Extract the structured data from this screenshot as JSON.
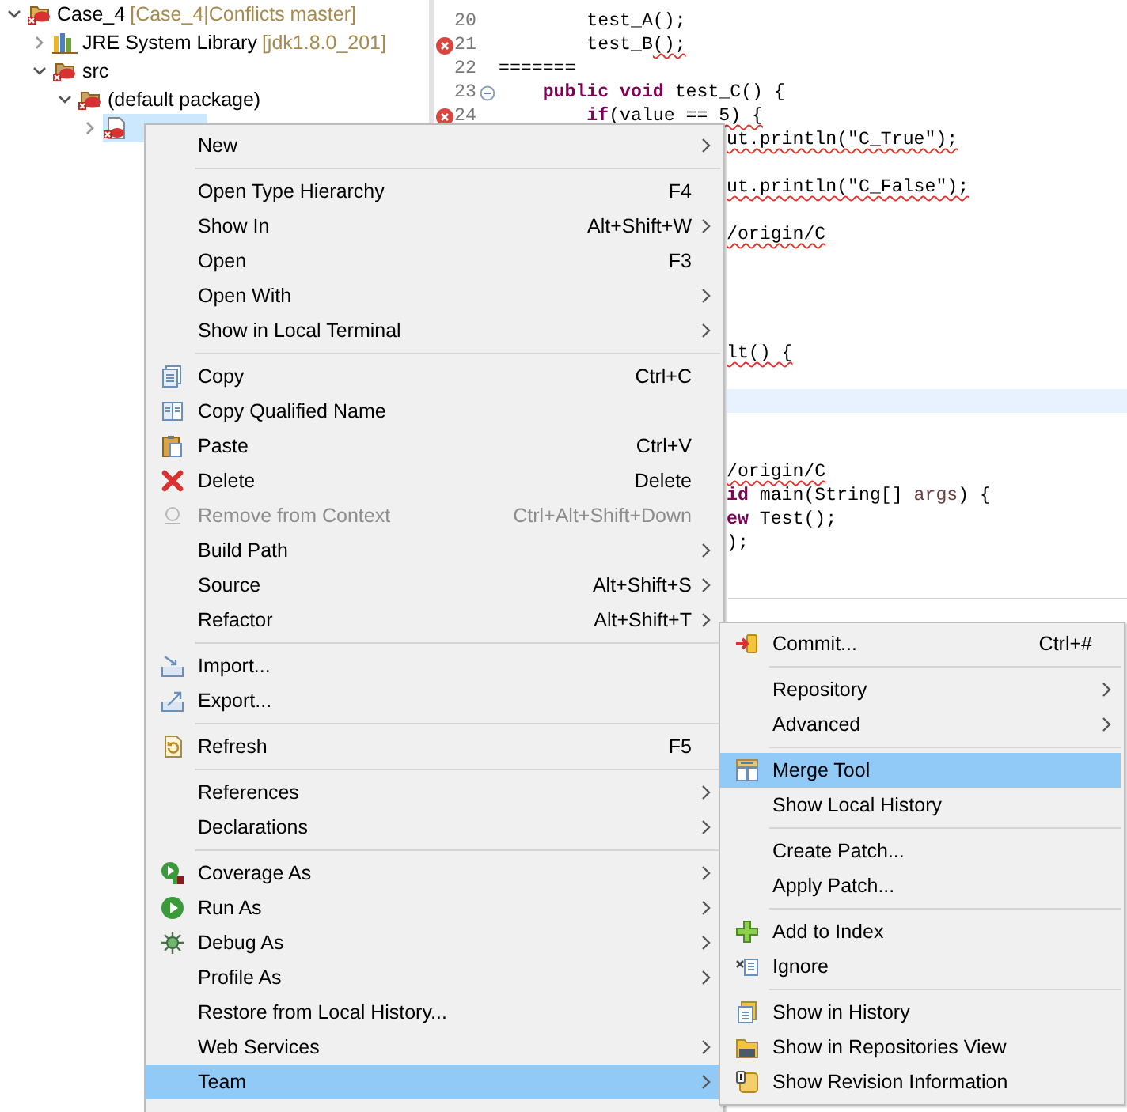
{
  "tree": [
    {
      "label": "Case_4",
      "decoration": "[Case_4|Conflicts master]",
      "expanded": true,
      "selected": false,
      "children": [
        {
          "label": "JRE System Library",
          "decoration": "[jdk1.8.0_201]",
          "expanded": false,
          "selected": false
        },
        {
          "label": "src",
          "expanded": true,
          "selected": false,
          "children": [
            {
              "label": "(default package)",
              "expanded": true,
              "selected": false,
              "children": [
                {
                  "expanded": false,
                  "selected": true
                }
              ]
            }
          ]
        }
      ]
    }
  ],
  "editor": {
    "lines": [
      {
        "kind": "full",
        "number": "20",
        "error": false,
        "fold": false,
        "segments": [
          {
            "kind": "text",
            "text": "        test_A();"
          }
        ]
      },
      {
        "kind": "full",
        "number": "21",
        "error": true,
        "fold": false,
        "segments": [
          {
            "kind": "text",
            "text": "        test_B"
          },
          {
            "kind": "error",
            "text": "();"
          }
        ]
      },
      {
        "kind": "full",
        "number": "22",
        "error": false,
        "fold": false,
        "segments": [
          {
            "kind": "text",
            "text": "======="
          }
        ]
      },
      {
        "kind": "full",
        "number": "23",
        "error": false,
        "fold": true,
        "segments": [
          {
            "kind": "keyword",
            "text": "    public void"
          },
          {
            "kind": "text",
            "text": " test_C() {"
          }
        ]
      },
      {
        "kind": "full",
        "number": "24",
        "error": true,
        "fold": false,
        "segments": [
          {
            "kind": "keyword",
            "text": "        if"
          },
          {
            "kind": "text",
            "text": "(value == "
          },
          {
            "kind": "error",
            "text": "5) {"
          }
        ]
      },
      {
        "kind": "tail",
        "segments": [
          {
            "kind": "error",
            "text": "ut.println(\"C_True\");"
          }
        ]
      },
      {
        "kind": "tail"
      },
      {
        "kind": "tail",
        "segments": [
          {
            "kind": "error",
            "text": "ut.println(\"C_False\");"
          }
        ]
      },
      {
        "kind": "tail"
      },
      {
        "kind": "tail",
        "segments": [
          {
            "kind": "error",
            "text": "/origin/C"
          }
        ]
      },
      {
        "kind": "tail"
      },
      {
        "kind": "tail"
      },
      {
        "kind": "tail"
      },
      {
        "kind": "tail"
      },
      {
        "kind": "tail",
        "segments": [
          {
            "kind": "error",
            "text": "lt() {"
          }
        ]
      },
      {
        "kind": "tail"
      },
      {
        "kind": "current"
      },
      {
        "kind": "tail"
      },
      {
        "kind": "tail"
      },
      {
        "kind": "tail",
        "segments": [
          {
            "kind": "error",
            "text": "/origin/C"
          }
        ]
      },
      {
        "kind": "tail",
        "segments": [
          {
            "kind": "keyword",
            "text": "id"
          },
          {
            "kind": "text",
            "text": " main(String[] "
          },
          {
            "kind": "param",
            "text": "args"
          },
          {
            "kind": "text",
            "text": ") {"
          }
        ]
      },
      {
        "kind": "tail",
        "segments": [
          {
            "kind": "keyword",
            "text": "ew"
          },
          {
            "kind": "text",
            "text": " Test();"
          }
        ]
      },
      {
        "kind": "tail",
        "segments": [
          {
            "kind": "text",
            "text": ");"
          }
        ]
      }
    ]
  },
  "context_menu": {
    "groups": [
      [
        {
          "label": "New",
          "submenu": true,
          "disabled": false,
          "selected": false
        }
      ],
      [
        {
          "label": "Open Type Hierarchy",
          "shortcut": "F4",
          "submenu": false,
          "disabled": false,
          "selected": false
        },
        {
          "label": "Show In",
          "shortcut": "Alt+Shift+W",
          "submenu": true,
          "disabled": false,
          "selected": false
        },
        {
          "label": "Open",
          "shortcut": "F3",
          "submenu": false,
          "disabled": false,
          "selected": false
        },
        {
          "label": "Open With",
          "submenu": true,
          "disabled": false,
          "selected": false
        },
        {
          "label": "Show in Local Terminal",
          "submenu": true,
          "disabled": false,
          "selected": false
        }
      ],
      [
        {
          "label": "Copy",
          "shortcut": "Ctrl+C",
          "submenu": false,
          "disabled": false,
          "selected": false
        },
        {
          "label": "Copy Qualified Name",
          "submenu": false,
          "disabled": false,
          "selected": false
        },
        {
          "label": "Paste",
          "shortcut": "Ctrl+V",
          "submenu": false,
          "disabled": false,
          "selected": false
        },
        {
          "label": "Delete",
          "shortcut": "Delete",
          "submenu": false,
          "disabled": false,
          "selected": false
        },
        {
          "label": "Remove from Context",
          "shortcut": "Ctrl+Alt+Shift+Down",
          "submenu": false,
          "disabled": true,
          "selected": false
        },
        {
          "label": "Build Path",
          "submenu": true,
          "disabled": false,
          "selected": false
        },
        {
          "label": "Source",
          "shortcut": "Alt+Shift+S",
          "submenu": true,
          "disabled": false,
          "selected": false
        },
        {
          "label": "Refactor",
          "shortcut": "Alt+Shift+T",
          "submenu": true,
          "disabled": false,
          "selected": false
        }
      ],
      [
        {
          "label": "Import...",
          "submenu": false,
          "disabled": false,
          "selected": false
        },
        {
          "label": "Export...",
          "submenu": false,
          "disabled": false,
          "selected": false
        }
      ],
      [
        {
          "label": "Refresh",
          "shortcut": "F5",
          "submenu": false,
          "disabled": false,
          "selected": false
        }
      ],
      [
        {
          "label": "References",
          "submenu": true,
          "disabled": false,
          "selected": false
        },
        {
          "label": "Declarations",
          "submenu": true,
          "disabled": false,
          "selected": false
        }
      ],
      [
        {
          "label": "Coverage As",
          "submenu": true,
          "disabled": false,
          "selected": false
        },
        {
          "label": "Run As",
          "submenu": true,
          "disabled": false,
          "selected": false
        },
        {
          "label": "Debug As",
          "submenu": true,
          "disabled": false,
          "selected": false
        },
        {
          "label": "Profile As",
          "submenu": true,
          "disabled": false,
          "selected": false
        },
        {
          "label": "Restore from Local History...",
          "submenu": false,
          "disabled": false,
          "selected": false
        },
        {
          "label": "Web Services",
          "submenu": true,
          "disabled": false,
          "selected": false
        },
        {
          "label": "Team",
          "submenu": true,
          "disabled": false,
          "selected": true
        }
      ]
    ]
  },
  "team_submenu": {
    "groups": [
      [
        {
          "label": "Commit...",
          "shortcut": "Ctrl+#",
          "submenu": false,
          "disabled": false,
          "selected": false
        }
      ],
      [
        {
          "label": "Repository",
          "submenu": true,
          "disabled": false,
          "selected": false
        },
        {
          "label": "Advanced",
          "submenu": true,
          "disabled": false,
          "selected": false
        }
      ],
      [
        {
          "label": "Merge Tool",
          "submenu": false,
          "disabled": false,
          "selected": true
        },
        {
          "label": "Show Local History",
          "submenu": false,
          "disabled": false,
          "selected": false
        }
      ],
      [
        {
          "label": "Create Patch...",
          "submenu": false,
          "disabled": false,
          "selected": false
        },
        {
          "label": "Apply Patch...",
          "submenu": false,
          "disabled": false,
          "selected": false
        }
      ],
      [
        {
          "label": "Add to Index",
          "submenu": false,
          "disabled": false,
          "selected": false
        },
        {
          "label": "Ignore",
          "submenu": false,
          "disabled": false,
          "selected": false
        }
      ],
      [
        {
          "label": "Show in History",
          "submenu": false,
          "disabled": false,
          "selected": false
        },
        {
          "label": "Show in Repositories View",
          "submenu": false,
          "disabled": false,
          "selected": false
        },
        {
          "label": "Show Revision Information",
          "submenu": false,
          "disabled": false,
          "selected": false
        }
      ]
    ]
  }
}
